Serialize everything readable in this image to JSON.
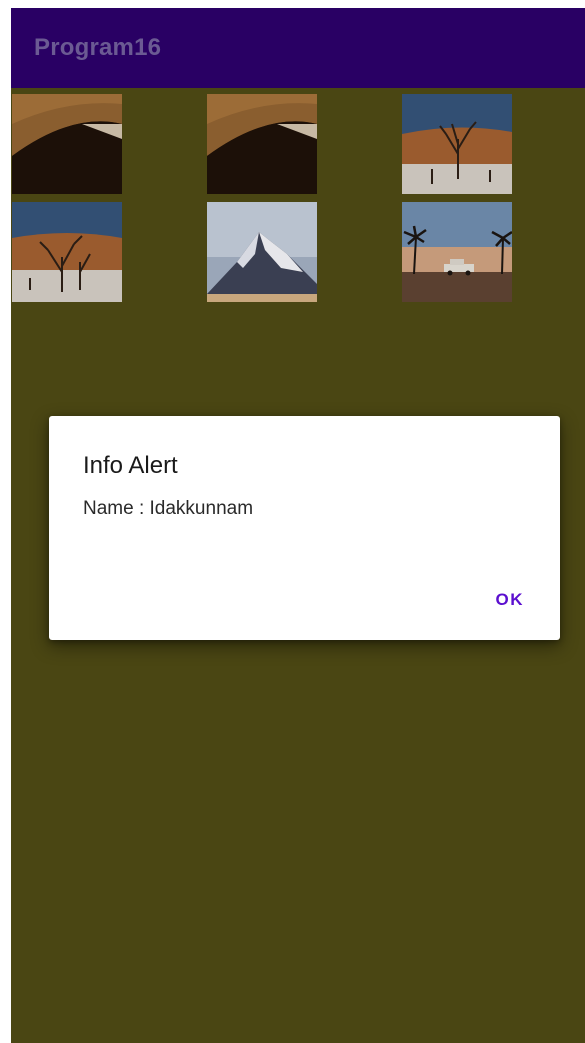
{
  "app_bar": {
    "title": "Program16",
    "background": "#290064",
    "title_color": "#6b5a93"
  },
  "screen": {
    "scrim_background": "#4a4613"
  },
  "image_grid": {
    "items": [
      {
        "subject": "desert dune shadow"
      },
      {
        "subject": "desert dune shadow"
      },
      {
        "subject": "dead tree on orange dune"
      },
      {
        "subject": "dead trees on orange dune"
      },
      {
        "subject": "snowy mountain peak"
      },
      {
        "subject": "car between palm trees at sunset"
      }
    ]
  },
  "dialog": {
    "title": "Info Alert",
    "message": "Name : Idakkunnam",
    "positive_button": "OK",
    "accent_color": "#5b0fcf"
  }
}
